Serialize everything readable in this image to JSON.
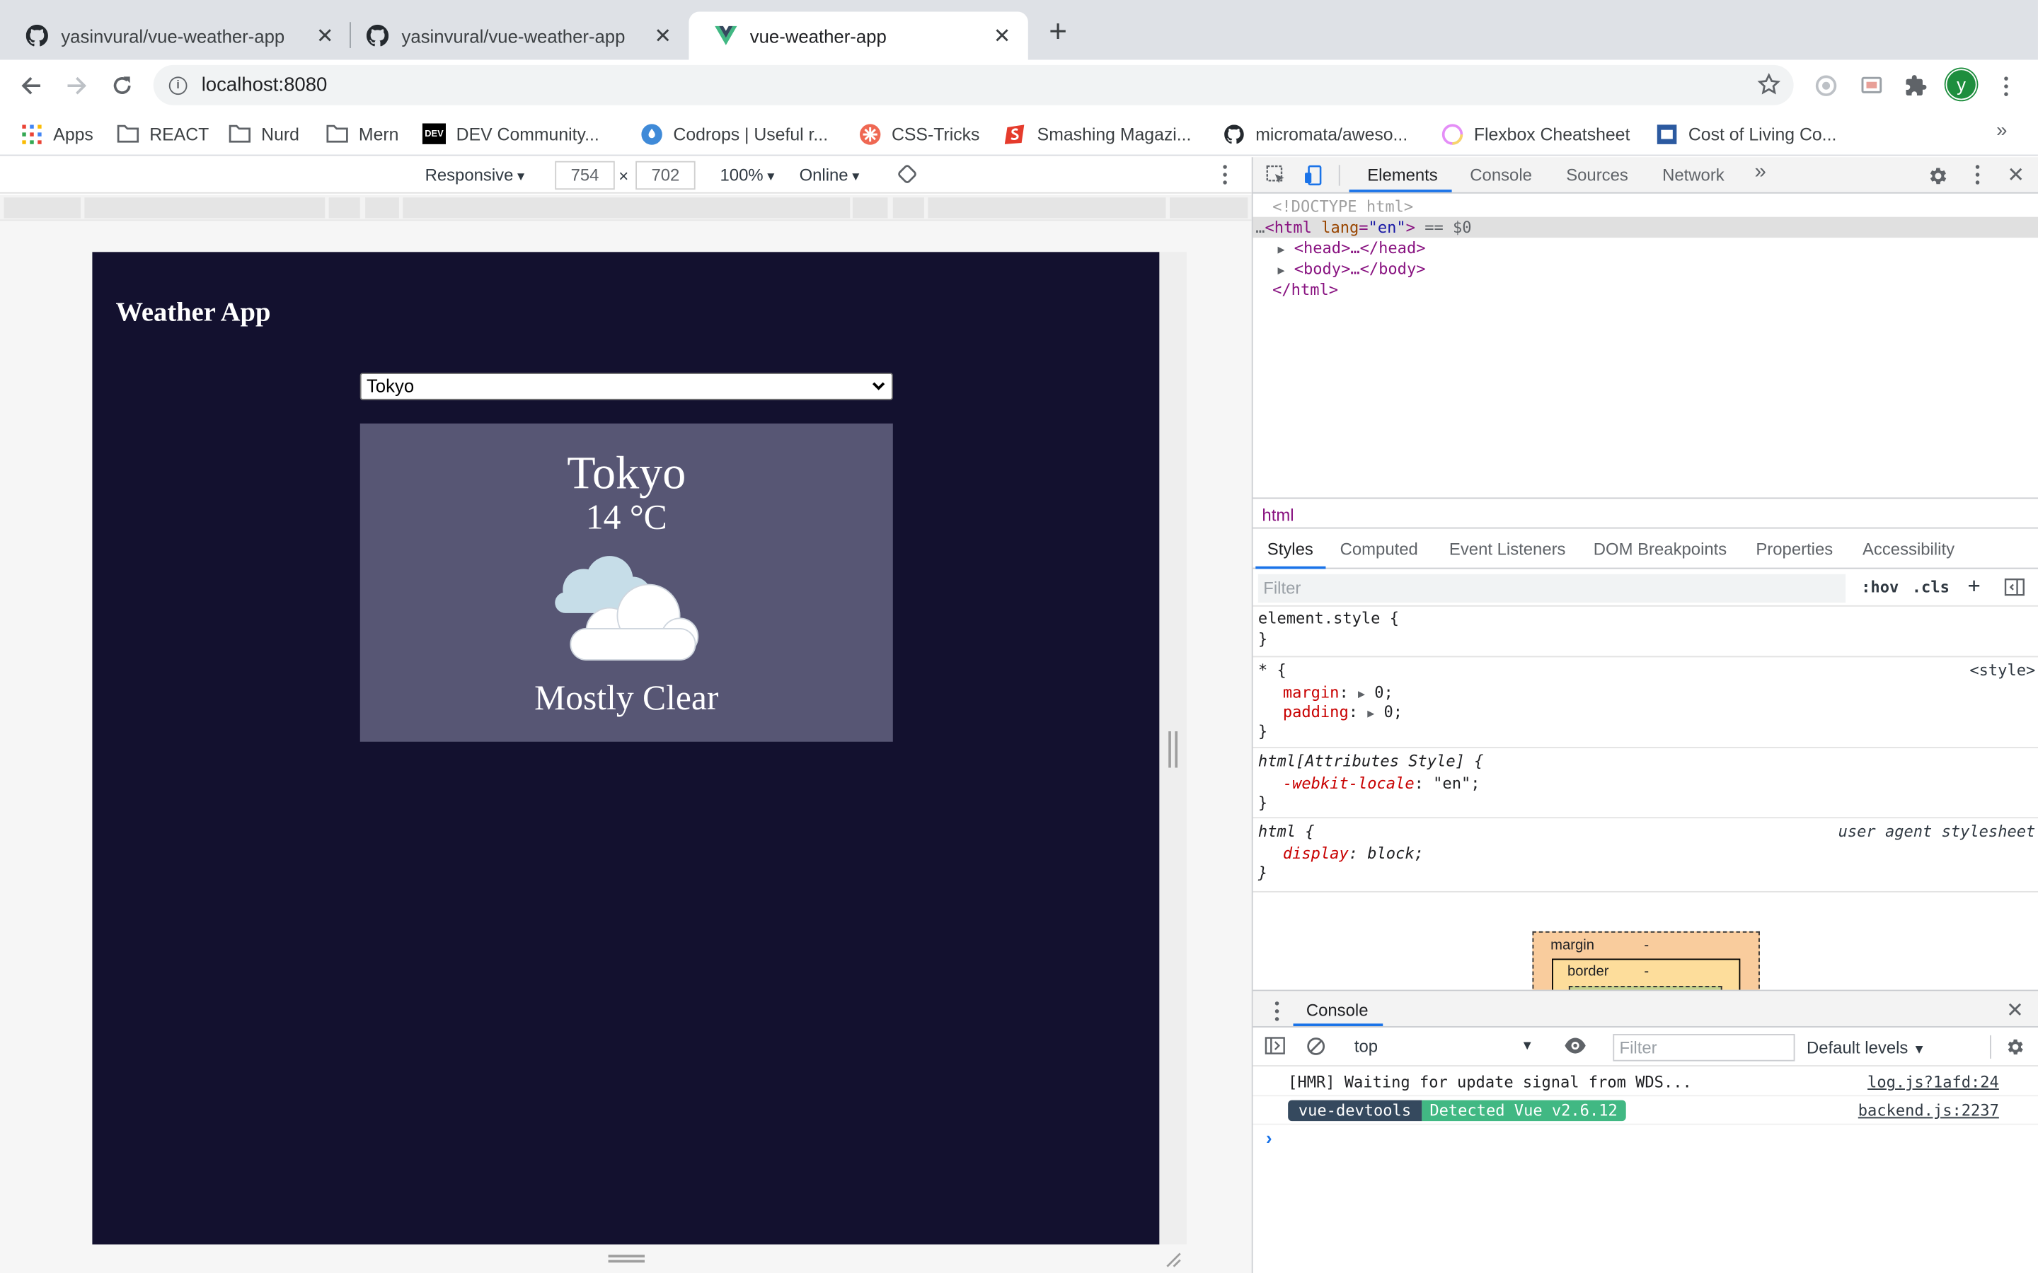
{
  "browser": {
    "tabs": [
      {
        "title": "yasinvural/vue-weather-app",
        "icon": "github-icon",
        "active": false
      },
      {
        "title": "yasinvural/vue-weather-app",
        "icon": "github-icon",
        "active": false
      },
      {
        "title": "vue-weather-app",
        "icon": "vue-icon",
        "active": true
      }
    ],
    "new_tab": "+",
    "url": "localhost:8080",
    "profile_initial": "y",
    "bookmarks": [
      {
        "label": "Apps",
        "icon": "apps-grid-icon"
      },
      {
        "label": "REACT",
        "icon": "folder-icon"
      },
      {
        "label": "Nurd",
        "icon": "folder-icon"
      },
      {
        "label": "Mern",
        "icon": "folder-icon"
      },
      {
        "label": "DEV Community...",
        "icon": "dev-icon"
      },
      {
        "label": "Codrops | Useful r...",
        "icon": "codrops-icon"
      },
      {
        "label": "CSS-Tricks",
        "icon": "css-tricks-icon"
      },
      {
        "label": "Smashing Magazi...",
        "icon": "smashing-icon"
      },
      {
        "label": "micromata/aweso...",
        "icon": "github-icon"
      },
      {
        "label": "Flexbox Cheatsheet",
        "icon": "flexbox-icon"
      },
      {
        "label": "Cost of Living Co...",
        "icon": "cost-icon"
      }
    ],
    "bookmarks_more": "»"
  },
  "device_toolbar": {
    "mode": "Responsive",
    "width": "754",
    "height": "702",
    "times": "×",
    "zoom": "100%",
    "network": "Online"
  },
  "app": {
    "title": "Weather App",
    "selected_city": "Tokyo",
    "card": {
      "city": "Tokyo",
      "temperature": "14 °C",
      "condition": "Mostly Clear",
      "icon": "cloudy-icon"
    }
  },
  "devtools": {
    "tabs": [
      "Elements",
      "Console",
      "Sources",
      "Network"
    ],
    "more": "»",
    "dom": {
      "doctype": "<!DOCTYPE html>",
      "html_open": "<html",
      "lang_attr": "lang",
      "lang_val": "\"en\"",
      "html_close_bracket": ">",
      "sel_marker": " == $0",
      "head": "<head>…</head>",
      "body": "<body>…</body>",
      "html_end": "</html>"
    },
    "breadcrumb": "html",
    "style_tabs": [
      "Styles",
      "Computed",
      "Event Listeners",
      "DOM Breakpoints",
      "Properties",
      "Accessibility"
    ],
    "filter_placeholder": "Filter",
    "hov": ":hov",
    "cls": ".cls",
    "rules": {
      "element_style": "element.style {",
      "close": "}",
      "star_selector": "* {",
      "star_source": "<style>",
      "margin_prop": "margin",
      "padding_prop": "padding",
      "zero": "0;",
      "attr_selector": "html[Attributes Style] {",
      "locale_prop": "-webkit-locale",
      "locale_val": "\"en\";",
      "html_selector": "html {",
      "ua_source": "user agent stylesheet",
      "display_prop": "display",
      "display_val": "block;"
    },
    "box_model": {
      "margin": "margin",
      "border": "border",
      "dash": "-"
    },
    "drawer": {
      "tab": "Console",
      "context": "top",
      "filter_placeholder": "Filter",
      "levels": "Default levels",
      "messages": [
        {
          "text": "[HMR] Waiting for update signal from WDS...",
          "source": "log.js?1afd:24"
        },
        {
          "badge_left": "vue-devtools",
          "badge_right": "Detected Vue v2.6.12",
          "source": "backend.js:2237"
        }
      ],
      "prompt": "›"
    }
  },
  "colors": {
    "app_background": "#13112f",
    "card_background": "#575674",
    "devtools_accent": "#1a73e8",
    "vue_green": "#41b883",
    "vue_navy": "#35495e"
  }
}
